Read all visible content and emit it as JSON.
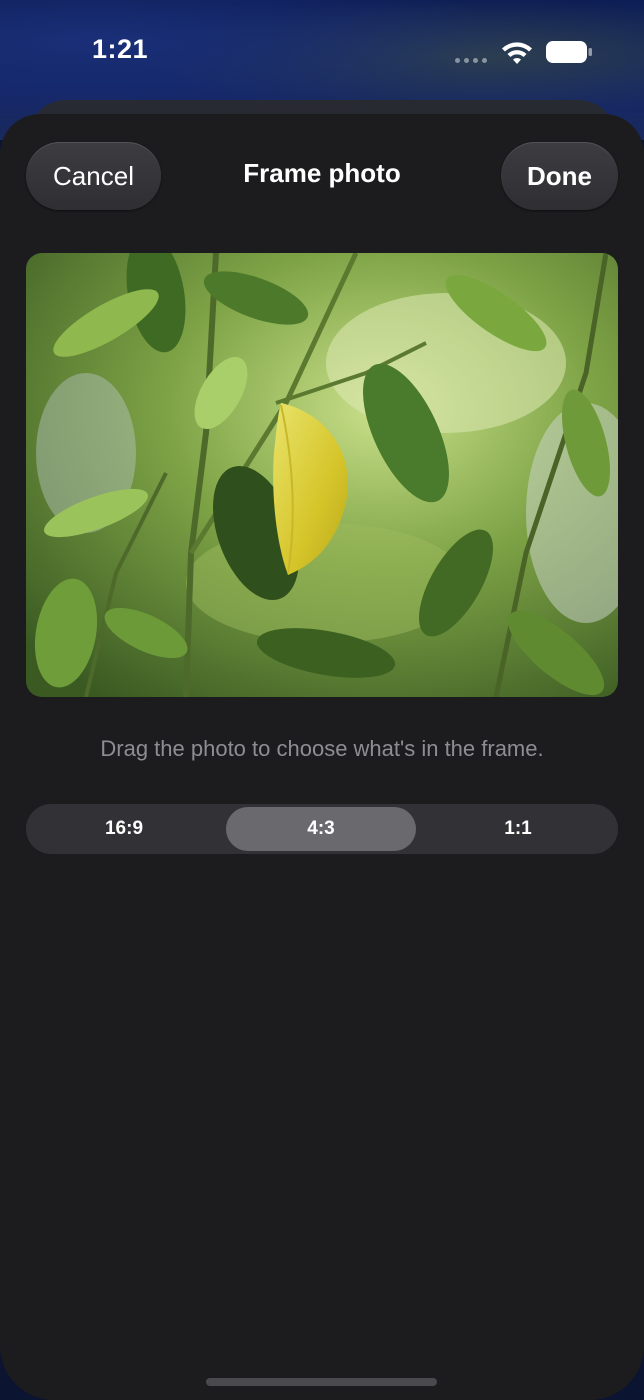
{
  "status_bar": {
    "time": "1:21",
    "icons": [
      "cellular-dots-icon",
      "wifi-icon",
      "battery-icon"
    ]
  },
  "sheet": {
    "title": "Frame photo",
    "cancel_label": "Cancel",
    "done_label": "Done",
    "hint": "Drag the photo to choose what's in the frame.",
    "aspect_options": [
      {
        "label": "16:9",
        "selected": false
      },
      {
        "label": "4:3",
        "selected": true
      },
      {
        "label": "1:1",
        "selected": false
      }
    ]
  },
  "colors": {
    "sheet_background": "#1c1c1e",
    "button_background": "#3a3a3e",
    "segment_track": "#323236",
    "segment_selected": "#69696e",
    "hint_text": "#8d8d93"
  }
}
